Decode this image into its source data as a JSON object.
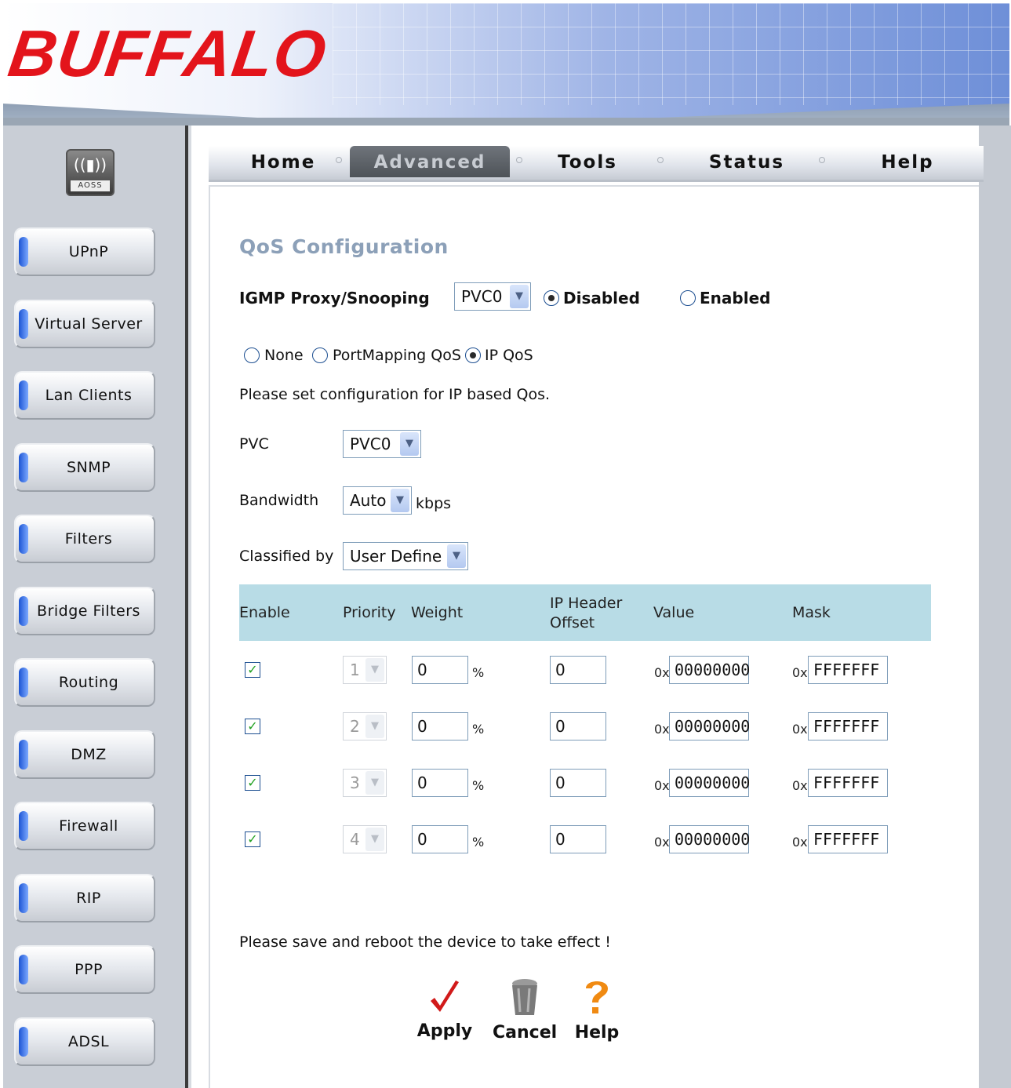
{
  "header": {
    "logo": "BUFFALO"
  },
  "sidebar": {
    "aoss_label": "AOSS",
    "items": [
      {
        "label": "UPnP"
      },
      {
        "label": "Virtual Server"
      },
      {
        "label": "Lan Clients"
      },
      {
        "label": "SNMP"
      },
      {
        "label": "Filters"
      },
      {
        "label": "Bridge Filters"
      },
      {
        "label": "Routing"
      },
      {
        "label": "DMZ"
      },
      {
        "label": "Firewall"
      },
      {
        "label": "RIP"
      },
      {
        "label": "PPP"
      },
      {
        "label": "ADSL"
      }
    ]
  },
  "tabs": [
    {
      "label": "Home",
      "active": false
    },
    {
      "label": "Advanced",
      "active": true
    },
    {
      "label": "Tools",
      "active": false
    },
    {
      "label": "Status",
      "active": false
    },
    {
      "label": "Help",
      "active": false
    }
  ],
  "page": {
    "title": "QoS Configuration",
    "igmp": {
      "label": "IGMP Proxy/Snooping",
      "pvc": "PVC0",
      "disabled_label": "Disabled",
      "enabled_label": "Enabled",
      "selected": "Disabled"
    },
    "qos_mode": {
      "options": [
        "None",
        "PortMapping QoS",
        "IP QoS"
      ],
      "selected": "IP QoS"
    },
    "instruction": "Please set configuration for IP based Qos.",
    "pvc": {
      "label": "PVC",
      "value": "PVC0"
    },
    "bandwidth": {
      "label": "Bandwidth",
      "value": "Auto",
      "unit": "kbps"
    },
    "classified_by": {
      "label": "Classified by",
      "value": "User Define"
    },
    "table": {
      "headers": {
        "enable": "Enable",
        "priority": "Priority",
        "weight": "Weight",
        "offset_line1": "IP Header",
        "offset_line2": "Offset",
        "value": "Value",
        "mask": "Mask"
      },
      "percent": "%",
      "hex_prefix": "0x",
      "rows": [
        {
          "enabled": true,
          "priority": "1",
          "weight": "0",
          "offset": "0",
          "value": "00000000",
          "mask": "FFFFFFF"
        },
        {
          "enabled": true,
          "priority": "2",
          "weight": "0",
          "offset": "0",
          "value": "00000000",
          "mask": "FFFFFFF"
        },
        {
          "enabled": true,
          "priority": "3",
          "weight": "0",
          "offset": "0",
          "value": "00000000",
          "mask": "FFFFFFF"
        },
        {
          "enabled": true,
          "priority": "4",
          "weight": "0",
          "offset": "0",
          "value": "00000000",
          "mask": "FFFFFFF"
        }
      ]
    },
    "notice": "Please save and reboot the device to take effect !",
    "actions": {
      "apply": "Apply",
      "cancel": "Cancel",
      "help": "Help"
    }
  },
  "colors": {
    "logo": "#e3141b",
    "title": "#8ca0b8",
    "table_header": "#b8dce6",
    "apply_check": "#d11a1a",
    "help_mark": "#f08a12"
  }
}
